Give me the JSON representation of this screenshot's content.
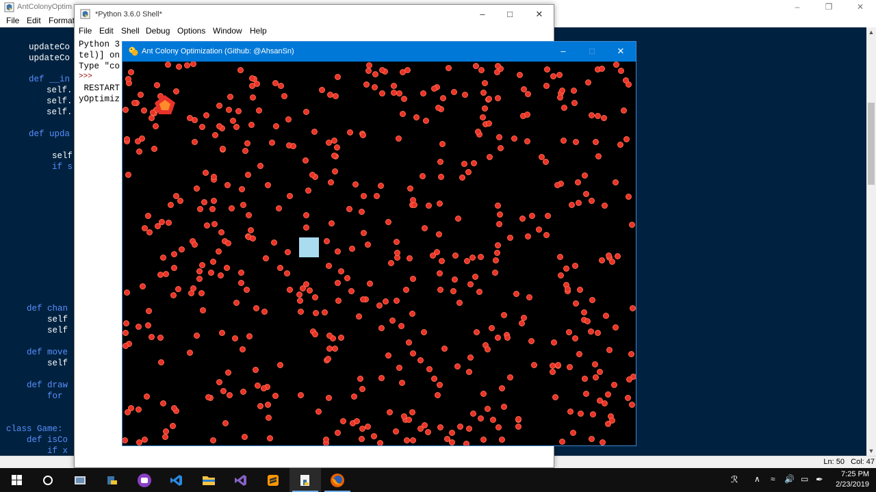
{
  "editor": {
    "title": "AntColonyOptim",
    "menu": [
      "File",
      "Edit",
      "Format"
    ],
    "code_lines": [
      {
        "indent": 2,
        "text": "updateCo",
        "kw": false
      },
      {
        "indent": 2,
        "text": "updateCo",
        "kw": false
      },
      {
        "indent": 0,
        "text": "",
        "kw": false
      },
      {
        "indent": 1,
        "text": "def __in",
        "kw": true
      },
      {
        "indent": 2,
        "text": "self.",
        "kw": false
      },
      {
        "indent": 2,
        "text": "self.",
        "kw": false
      },
      {
        "indent": 2,
        "text": "self.",
        "kw": false
      },
      {
        "indent": 0,
        "text": "",
        "kw": false
      },
      {
        "indent": 1,
        "text": "def upda",
        "kw": true
      },
      {
        "indent": 0,
        "text": "",
        "kw": false
      },
      {
        "indent": 2,
        "text": "self",
        "kw": false
      },
      {
        "indent": 2,
        "text": "if s",
        "kw": true
      }
    ],
    "code_lines_lower": [
      {
        "text": "    def chan",
        "kw": true
      },
      {
        "text": "        self",
        "kw": false
      },
      {
        "text": "        self",
        "kw": false
      },
      {
        "text": "",
        "kw": false
      },
      {
        "text": "    def move",
        "kw": true
      },
      {
        "text": "        self",
        "kw": false
      },
      {
        "text": "",
        "kw": false
      },
      {
        "text": "    def draw",
        "kw": true
      },
      {
        "text": "        for ",
        "kw": true
      },
      {
        "text": "",
        "kw": false
      },
      {
        "text": "",
        "kw": false
      },
      {
        "text": "class Game:",
        "kw": true
      },
      {
        "text": "    def isCo",
        "kw": true
      },
      {
        "text": "        if x",
        "kw": true
      }
    ],
    "status": {
      "ln": "Ln: 50",
      "col": "Col: 47"
    }
  },
  "shell": {
    "title": "*Python 3.6.0 Shell*",
    "menu": [
      "File",
      "Edit",
      "Shell",
      "Debug",
      "Options",
      "Window",
      "Help"
    ],
    "lines": [
      "Python 3",
      "tel)] on",
      "Type \"co",
      ">>>",
      " RESTART",
      "yOptimiz"
    ]
  },
  "game": {
    "title": "Ant Colony Optimization (Github: @AhsanSn)",
    "colors": {
      "background": "#000000",
      "ant": "#e8322a",
      "nest": "#a9dcef",
      "food": "#e8322a",
      "food_inner": "#ff8c2a"
    },
    "ant_count": 540
  },
  "taskbar": {
    "apps": [
      "start",
      "cortana",
      "snipping-tool",
      "python-idle",
      "unknown-purple-app",
      "visual-studio-code",
      "file-explorer",
      "visual-studio",
      "sublime-text",
      "python-file",
      "firefox"
    ],
    "clock_time": "7:25 PM",
    "clock_date": "2/23/2019"
  }
}
